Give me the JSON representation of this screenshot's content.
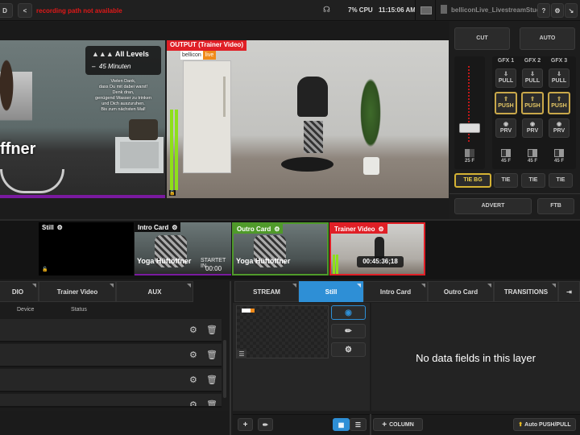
{
  "topbar": {
    "left_button_label": "D",
    "share_icon": "share-icon",
    "recording_status": "recording path not available",
    "cpu": "7% CPU",
    "clock": "11:15:06 AM",
    "document_name": "belliconLive_LivestreamStudi...",
    "help_icon": "help-icon",
    "settings_icon": "gear-icon",
    "collapse_icon": "collapse-icon"
  },
  "preview": {
    "card_title": "All Levels",
    "card_duration": "45 Minuten",
    "message": [
      "Vielen Dank,",
      "dass Du mit dabei warst!",
      "Denk dran,",
      "genügend Wasser zu trinken",
      "und Dich auszuruhen.",
      "Bis zum nächsten Mal!"
    ],
    "title_fragment": "ffner"
  },
  "program": {
    "label": "OUTPUT (Trainer Video)",
    "logo_left": "bellicon",
    "logo_right": "live"
  },
  "controls": {
    "cut": "CUT",
    "auto": "AUTO",
    "gfx": [
      {
        "label": "GFX 1",
        "pull": "PULL",
        "push": "PUSH",
        "prv": "PRV",
        "frames": "45 F",
        "tie": "TIE"
      },
      {
        "label": "GFX 2",
        "pull": "PULL",
        "push": "PUSH",
        "prv": "PRV",
        "frames": "45 F",
        "tie": "TIE"
      },
      {
        "label": "GFX 3",
        "pull": "PULL",
        "push": "PUSH",
        "prv": "PRV",
        "frames": "45 F",
        "tie": "TIE"
      }
    ],
    "bg_frames": "25 F",
    "tie_bg": "TIE BG",
    "advert": "ADVERT",
    "ftb": "FTB",
    "tbar_position": 0.0
  },
  "shots": [
    {
      "label": "Still",
      "state": "none"
    },
    {
      "label": "Intro Card",
      "state": "preview",
      "title": "Yoga Hüftöffner",
      "start_label": "STARTET IN",
      "start_time": "00:00",
      "color": "#7a1aa0"
    },
    {
      "label": "Outro Card",
      "state": "graphics",
      "title": "Yoga Hüftöffner",
      "color": "#4f9a2a"
    },
    {
      "label": "Trainer Video",
      "state": "program",
      "timecode": "00:45:36;18",
      "color": "#e01f26"
    }
  ],
  "left_tabs": [
    "DIO",
    "Trainer Video",
    "AUX"
  ],
  "left_columns": {
    "device": "Device",
    "status": "Status"
  },
  "left_rows": 4,
  "right_tabs": [
    {
      "label": "STREAM",
      "active": false
    },
    {
      "label": "Still",
      "active": true
    },
    {
      "label": "Intro Card",
      "active": false
    },
    {
      "label": "Outro Card",
      "active": false
    },
    {
      "label": "TRANSITIONS",
      "active": false
    }
  ],
  "layer_panel": {
    "empty_message": "No data fields in this layer",
    "add_column": "COLUMN",
    "auto_push_pull": "Auto PUSH/PULL"
  }
}
